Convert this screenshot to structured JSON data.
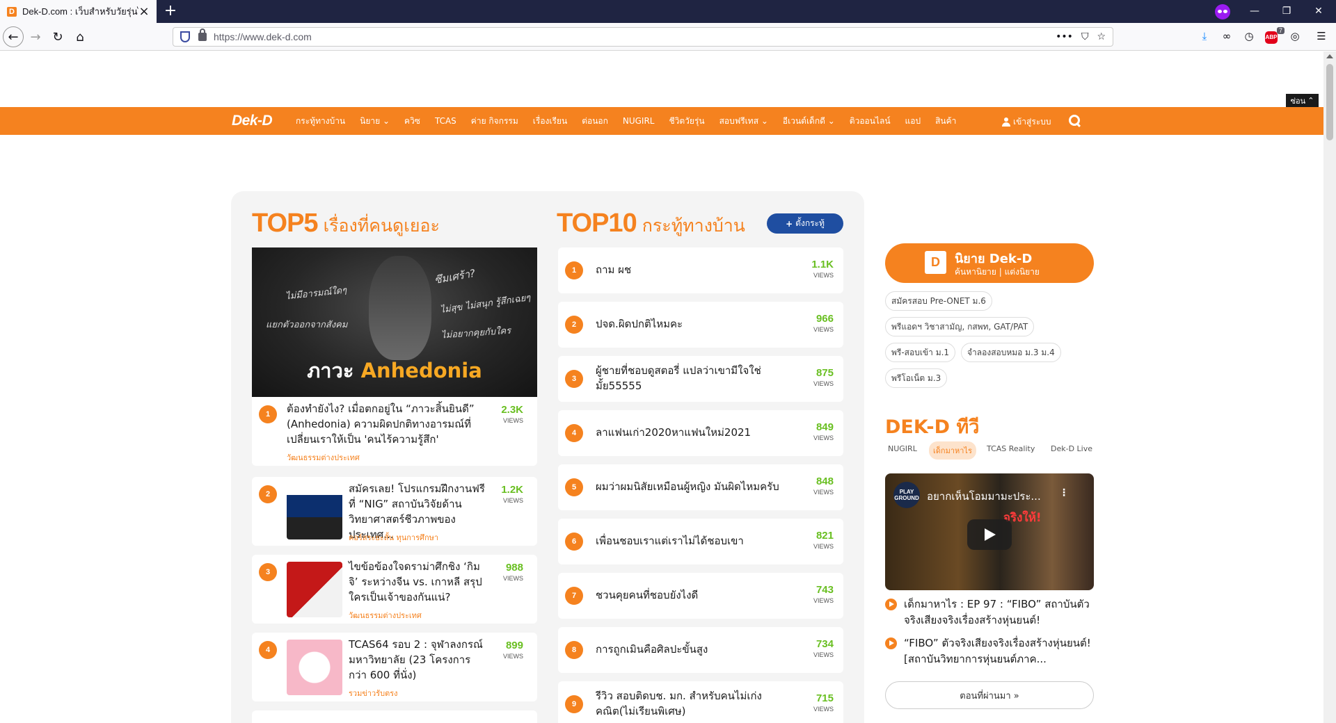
{
  "browser": {
    "tab_title": "Dek-D.com : เว็บสำหรับวัยรุ่นไทย",
    "tab_favicon": "D",
    "new_tab_icon": "plus-icon",
    "url": "https://www.dek-d.com",
    "addon_badge": "7",
    "abp_label": "ABP"
  },
  "site": {
    "hide_label": "ซ่อน",
    "logo": "Dek-D",
    "menu": [
      "กระทู้ทางบ้าน",
      "นิยาย",
      "ควิซ",
      "TCAS",
      "ค่าย กิจกรรม",
      "เรื่องเรียน",
      "ต่อนอก",
      "NUGIRL",
      "ชีวิตวัยรุ่น",
      "สอบฟรีเทส",
      "อีเวนต์เด็กดี",
      "ติวออนไลน์",
      "แอป",
      "สินค้า"
    ],
    "login_label": "เข้าสู่ระบบ"
  },
  "top5": {
    "heading_big": "TOP5",
    "heading_small": "เรื่องที่คนดูเยอะ",
    "hero": {
      "title_prefix": "ภาวะ",
      "title_highlight": "Anhedonia",
      "quotes": [
        "ไม่มีอารมณ์ใดๆ",
        "ซึมเศร้า?",
        "ไม่สุข ไม่สนุก รู้สึกเฉยๆ",
        "แยกตัวออกจากสังคม",
        "ไม่อยากคุยกับใคร"
      ]
    },
    "items": [
      {
        "rank": "1",
        "title": "ต้องทำยังไง? เมื่อตกอยู่ใน “ภาวะสิ้นยินดี” (Anhedonia) ความผิดปกติทางอารมณ์ที่เปลี่ยนเราให้เป็น 'คนไร้ความรู้สึก'",
        "category": "วัฒนธรรมต่างประเทศ",
        "views": "2.3K"
      },
      {
        "rank": "2",
        "title": "สมัครเลย! โปรแกรมฝึกงานฟรีที่ “NIG” สถาบันวิจัยด้านวิทยาศาสตร์ชีวภาพของประเทศ...",
        "category": "คอร์สระยะสั้น ทุนการศึกษา",
        "views": "1.2K"
      },
      {
        "rank": "3",
        "title": "ไขข้อข้องใจดราม่าศึกชิง ‘กิมจิ’ ระหว่างจีน vs. เกาหลี สรุปใครเป็นเจ้าของกันแน่?",
        "category": "วัฒนธรรมต่างประเทศ",
        "views": "988"
      },
      {
        "rank": "4",
        "title": "TCAS64 รอบ 2 : จุฬาลงกรณ์มหาวิทยาลัย (23 โครงการ กว่า 600 ที่นั่ง)",
        "category": "รวมข่าวรับตรง",
        "views": "899"
      }
    ],
    "views_label": "VIEWS"
  },
  "top10": {
    "heading_big": "TOP10",
    "heading_small": "กระทู้ทางบ้าน",
    "post_button": "ตั้งกระทู้",
    "items": [
      {
        "rank": "1",
        "title": "ถาม ผช",
        "views": "1.1K"
      },
      {
        "rank": "2",
        "title": "ปจด.ผิดปกติไหมคะ",
        "views": "966"
      },
      {
        "rank": "3",
        "title": "ผู้ชายที่ชอบดูสตอรี่ แปลว่าเขามีใจใช่มั้ย55555",
        "views": "875"
      },
      {
        "rank": "4",
        "title": "ลาแฟนเก่า2020หาแฟนใหม่2021",
        "views": "849"
      },
      {
        "rank": "5",
        "title": "ผมว่าผมนิสัยเหมือนผู้หญิง มันผิดไหมครับ",
        "views": "848"
      },
      {
        "rank": "6",
        "title": "เพื่อนชอบเราแต่เราไม่ได้ชอบเขา",
        "views": "821"
      },
      {
        "rank": "7",
        "title": "ชวนคุยคนที่ชอบยังไงดี",
        "views": "743"
      },
      {
        "rank": "8",
        "title": "การถูกเมินคือศิลปะขั้นสูง",
        "views": "734"
      },
      {
        "rank": "9",
        "title": "รีวิว สอบติดบช. มก. สำหรับคนไม่เก่งคณิต(ไม่เรียนพิเศษ)",
        "views": "715"
      }
    ],
    "views_label": "VIEWS"
  },
  "sidebar": {
    "novel_title": "นิยาย Dek-D",
    "novel_sub1": "ค้นหานิยาย",
    "novel_sub2": "แต่งนิยาย",
    "tags": [
      "สมัครสอบ Pre-ONET ม.6",
      "พรีแอดฯ วิชาสามัญ, กสพท, GAT/PAT",
      "พรี-สอบเข้า ม.1",
      "จำลองสอบหมอ ม.3 ม.4",
      "พรีโอเน็ต ม.3"
    ],
    "tv_heading": "DEK-D ทีวี",
    "tv_tabs": [
      "NUGIRL",
      "เด็กมาหาไร",
      "TCAS Reality",
      "Dek-D Live"
    ],
    "video_title": "อยากเห็นโอมมามะประ...",
    "video_channel": "PLAY GROUND",
    "video_caption": "จริงให้!",
    "episodes": [
      "เด็กมาหาไร : EP 97 : “FIBO” สถาบันตัวจริงเสียงจริงเรื่องสร้างหุ่นยนต์!",
      "“FIBO” ตัวจริงเสียงจริงเรื่องสร้างหุ่นยนต์! [สถาบันวิทยาการหุ่นยนต์ภาค..."
    ],
    "past_button": "ตอนที่ผ่านมา »"
  }
}
